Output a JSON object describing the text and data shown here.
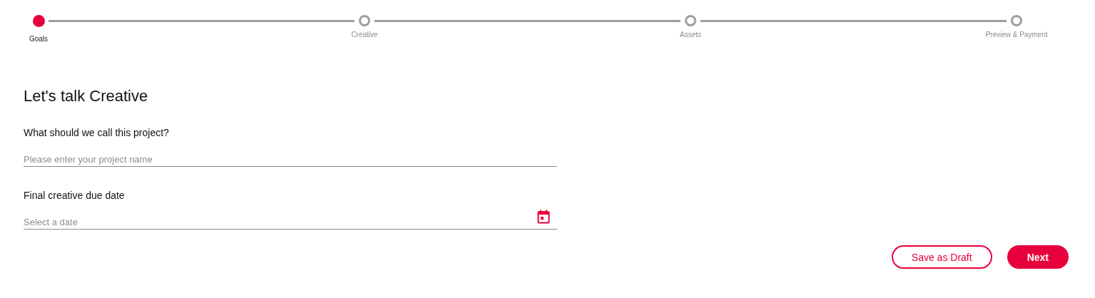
{
  "stepper": [
    {
      "label": "Goals",
      "selected": true
    },
    {
      "label": "Creative",
      "selected": false
    },
    {
      "label": "Assets",
      "selected": false
    },
    {
      "label": "Preview & Payment",
      "selected": false
    }
  ],
  "title": "Let's talk Creative",
  "fields": [
    {
      "kind": "text",
      "label": "What should we call this project?",
      "placeholder": "Please enter your project name"
    },
    {
      "kind": "date",
      "label": "Final creative due date",
      "placeholder": "Select a date"
    }
  ],
  "buttons": [
    {
      "kind": "secondary",
      "label": "Save as Draft"
    },
    {
      "kind": "primary",
      "label": "Next"
    }
  ]
}
